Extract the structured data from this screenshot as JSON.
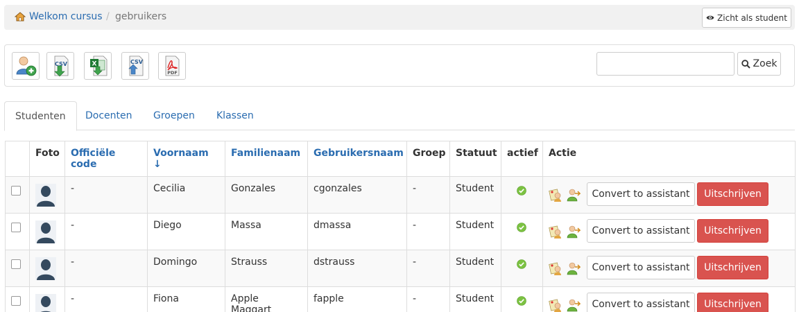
{
  "breadcrumb": {
    "home_icon": "home-icon",
    "link": "Welkom cursus",
    "separator": "/",
    "current": "gebruikers"
  },
  "student_view": {
    "icon": "eye-icon",
    "label": "Zicht als student"
  },
  "toolbar": {
    "buttons": [
      {
        "name": "add-user",
        "icon": "add-user-icon"
      },
      {
        "name": "export-csv",
        "icon": "csv-export-icon"
      },
      {
        "name": "export-xls",
        "icon": "excel-export-icon"
      },
      {
        "name": "import-csv",
        "icon": "csv-import-icon"
      },
      {
        "name": "export-pdf",
        "icon": "pdf-export-icon"
      }
    ],
    "search_placeholder": "",
    "search_label": "Zoek"
  },
  "tabs": [
    "Studenten",
    "Docenten",
    "Groepen",
    "Klassen"
  ],
  "table": {
    "headers": {
      "photo": "Foto",
      "official_code": "Officiële code",
      "firstname": "Voornaam ↓",
      "lastname": "Familienaam",
      "username": "Gebruikersnaam",
      "group": "Groep",
      "status": "Statuut",
      "active": "actief",
      "action": "Actie"
    },
    "rows": [
      {
        "official_code": "-",
        "firstname": "Cecilia",
        "lastname": "Gonzales",
        "username": "cgonzales",
        "group": "-",
        "status": "Student",
        "active": true
      },
      {
        "official_code": "-",
        "firstname": "Diego",
        "lastname": "Massa",
        "username": "dmassa",
        "group": "-",
        "status": "Student",
        "active": true
      },
      {
        "official_code": "-",
        "firstname": "Domingo",
        "lastname": "Strauss",
        "username": "dstrauss",
        "group": "-",
        "status": "Student",
        "active": true
      },
      {
        "official_code": "-",
        "firstname": "Fiona",
        "lastname": "Apple Maggart",
        "username": "fapple",
        "group": "-",
        "status": "Student",
        "active": true
      }
    ],
    "convert_label": "Convert to assistant",
    "unsubscribe_label": "Uitschrijven"
  },
  "colors": {
    "link": "#2a6cb0",
    "danger": "#d9534f",
    "active_ok": "#7cc242"
  }
}
